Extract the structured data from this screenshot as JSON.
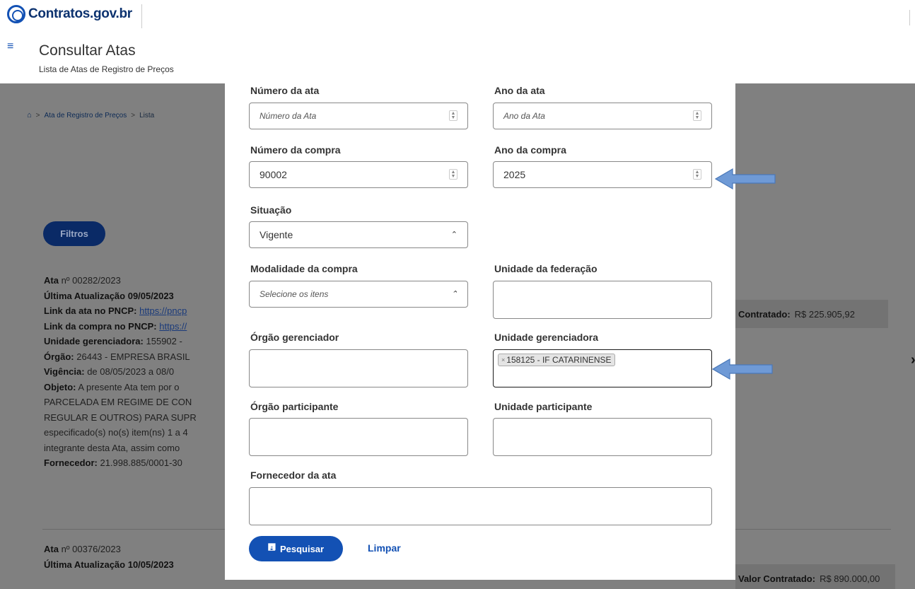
{
  "header": {
    "logo_text": "Contratos.gov.br",
    "menu_icon": "≡",
    "page_title": "Consultar Atas",
    "page_subtitle": "Lista de Atas de Registro de Preços"
  },
  "breadcrumb": {
    "home_icon": "home-icon",
    "items": [
      "Ata de Registro de Preços",
      "Lista"
    ]
  },
  "filters_button": "Filtros",
  "cards": [
    {
      "ata_label": "Ata",
      "ata_number": "nº 00282/2023",
      "last_update_label": "Última Atualização 09/05/2023",
      "link_ata_label": "Link da ata no PNCP:",
      "link_ata_value": "https://pncp",
      "link_compra_label": "Link da compra no PNCP:",
      "link_compra_value": "https://",
      "unidade_label": "Unidade gerenciadora:",
      "unidade_value": "155902 -",
      "orgao_label": "Órgão:",
      "orgao_value": "26443 - EMPRESA BRASIL",
      "vigencia_label": "Vigência:",
      "vigencia_value": "de 08/05/2023 a 08/0",
      "objeto_label": "Objeto:",
      "objeto_lines": [
        "A presente Ata tem por o",
        "PARCELADA EM REGIME DE CON",
        "REGULAR E OUTROS) PARA SUPR",
        "especificado(s) no(s) item(ns) 1 a 4",
        "integrante desta Ata, assim como"
      ],
      "fornecedor_label": "Fornecedor:",
      "fornecedor_value": "21.998.885/0001-30",
      "valor_label": "Contratado:",
      "valor_value": "R$ 225.905,92"
    },
    {
      "ata_label": "Ata",
      "ata_number": "nº 00376/2023",
      "last_update_label": "Última Atualização 10/05/2023",
      "valor_label": "Valor Contratado:",
      "valor_value": "R$ 890.000,00"
    }
  ],
  "modal": {
    "numero_ata": {
      "label": "Número da ata",
      "placeholder": "Número da Ata"
    },
    "ano_ata": {
      "label": "Ano da ata",
      "placeholder": "Ano da Ata"
    },
    "numero_compra": {
      "label": "Número da compra",
      "value": "90002"
    },
    "ano_compra": {
      "label": "Ano da compra",
      "value": "2025"
    },
    "situacao": {
      "label": "Situação",
      "value": "Vigente"
    },
    "modalidade": {
      "label": "Modalidade da compra",
      "placeholder": "Selecione os itens"
    },
    "uf": {
      "label": "Unidade da federação"
    },
    "orgao_gerenciador": {
      "label": "Órgão gerenciador"
    },
    "unidade_gerenciadora": {
      "label": "Unidade gerenciadora",
      "tag_remove": "×",
      "tag": "158125 - IF CATARINENSE"
    },
    "orgao_participante": {
      "label": "Órgão participante"
    },
    "unidade_participante": {
      "label": "Unidade participante"
    },
    "fornecedor": {
      "label": "Fornecedor da ata"
    },
    "search_button": "Pesquisar",
    "clear_button": "Limpar"
  },
  "colors": {
    "primary": "#1351b4",
    "overlay": "#808080",
    "arrow": "#6f9ad6"
  }
}
